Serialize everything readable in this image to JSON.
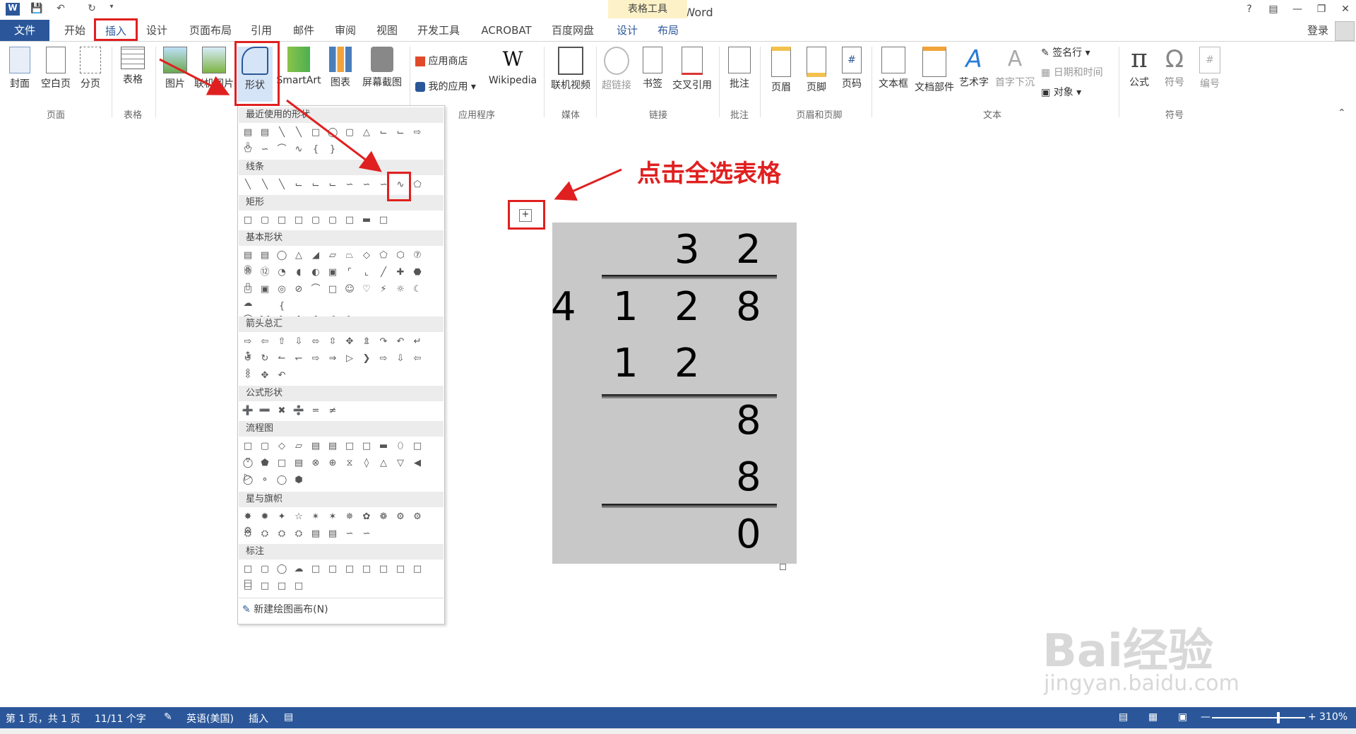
{
  "title": "文档1 - Word",
  "context_tab_header": "表格工具",
  "login": "登录",
  "tabs": {
    "file": "文件",
    "home": "开始",
    "insert": "插入",
    "design": "设计",
    "layout": "页面布局",
    "references": "引用",
    "mailings": "邮件",
    "review": "审阅",
    "view": "视图",
    "developer": "开发工具",
    "acrobat": "ACROBAT",
    "baidu": "百度网盘",
    "tbl_design": "设计",
    "tbl_layout": "布局"
  },
  "ribbon": {
    "cover": "封面",
    "blank": "空白页",
    "pagebreak": "分页",
    "grp_pages": "页面",
    "table": "表格",
    "grp_tables": "表格",
    "picture": "图片",
    "online_picture": "联机图片",
    "shapes": "形状",
    "smartart": "SmartArt",
    "chart": "图表",
    "screenshot": "屏幕截图",
    "store": "应用商店",
    "myapps": "我的应用",
    "wikipedia": "Wikipedia",
    "grp_apps": "应用程序",
    "online_video": "联机视频",
    "grp_media": "媒体",
    "hyperlink": "超链接",
    "bookmark": "书签",
    "crossref": "交叉引用",
    "grp_links": "链接",
    "comment": "批注",
    "grp_comments": "批注",
    "header": "页眉",
    "footer": "页脚",
    "pagenum": "页码",
    "grp_headerfooter": "页眉和页脚",
    "textbox": "文本框",
    "quickparts": "文档部件",
    "wordart": "艺术字",
    "dropcap": "首字下沉",
    "signature": "签名行",
    "datetime": "日期和时间",
    "object": "对象",
    "grp_text": "文本",
    "equation": "公式",
    "symbol": "符号",
    "number": "编号",
    "grp_symbols": "符号"
  },
  "shapes_menu": {
    "recent": "最近使用的形状",
    "lines": "线条",
    "rect": "矩形",
    "basic": "基本形状",
    "arrows": "箭头总汇",
    "equation": "公式形状",
    "flowchart": "流程图",
    "stars": "星与旗帜",
    "callouts": "标注",
    "new_canvas": "新建绘图画布(N)"
  },
  "annotation": "点击全选表格",
  "table_digits": {
    "r1a": "3",
    "r1b": "2",
    "divisor": "4",
    "r2a": "1",
    "r2b": "2",
    "r2c": "8",
    "r3a": "1",
    "r3b": "2",
    "r4": "8",
    "r5": "8",
    "r6": "0"
  },
  "status": {
    "page": "第 1 页，共 1 页",
    "words": "11/11 个字",
    "lang": "英语(美国)",
    "mode": "插入",
    "zoom": "310%"
  },
  "watermark": {
    "brand": "Bai经验",
    "url": "jingyan.baidu.com"
  }
}
